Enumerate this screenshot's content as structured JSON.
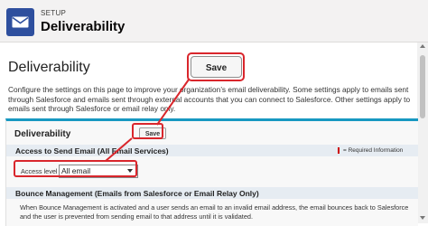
{
  "header": {
    "section_label": "SETUP",
    "title": "Deliverability",
    "icon": "envelope-icon",
    "icon_bg": "#2e4f9e"
  },
  "page": {
    "heading": "Deliverability",
    "intro": "Configure the settings on this page to improve your organization’s email deliverability. Some settings apply to emails sent through Salesforce and emails sent through external accounts that you can connect to Salesforce. Other settings apply to emails sent through Salesforce or email relay only.",
    "save_label": "Save"
  },
  "panel": {
    "title": "Deliverability",
    "save_label": "Save",
    "accent": "#1798c1",
    "access_section": {
      "title": "Access to Send Email (All Email Services)",
      "required_info": "= Required Information",
      "access_level_label": "Access level",
      "access_level_value": "All email"
    },
    "bounce_section": {
      "title": "Bounce Management (Emails from Salesforce or Email Relay Only)",
      "text": "When Bounce Management is activated and a user sends an email to an invalid email address, the email bounces back to Salesforce and the user is prevented from sending email to that address until it is validated."
    }
  },
  "annotations": {
    "highlight_color": "#d9262c"
  }
}
